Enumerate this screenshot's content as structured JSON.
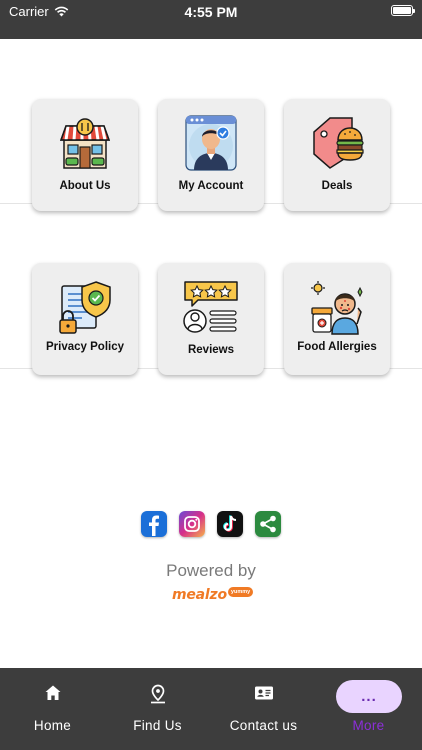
{
  "status_bar": {
    "carrier": "Carrier",
    "time": "4:55 PM"
  },
  "menu": {
    "row1": [
      {
        "label": "About Us",
        "icon": "store-icon"
      },
      {
        "label": "My Account",
        "icon": "account-icon"
      },
      {
        "label": "Deals",
        "icon": "deals-icon"
      }
    ],
    "row2": [
      {
        "label": "Privacy Policy",
        "icon": "privacy-shield-icon"
      },
      {
        "label": "Reviews",
        "icon": "reviews-icon"
      },
      {
        "label": "Food Allergies",
        "icon": "food-allergy-icon"
      }
    ]
  },
  "social": [
    "facebook-icon",
    "instagram-icon",
    "tiktok-icon",
    "share-icon"
  ],
  "footer": {
    "powered_by": "Powered by",
    "brand": "mealzo",
    "brand_badge": "yummy"
  },
  "tabs": {
    "home": "Home",
    "find": "Find Us",
    "contact": "Contact us",
    "more": "More",
    "more_pill": "..."
  },
  "colors": {
    "bars": "#3d3d3d",
    "accent": "#8c2fd8",
    "pill": "#e9d4ff",
    "brand": "#f07a25"
  }
}
